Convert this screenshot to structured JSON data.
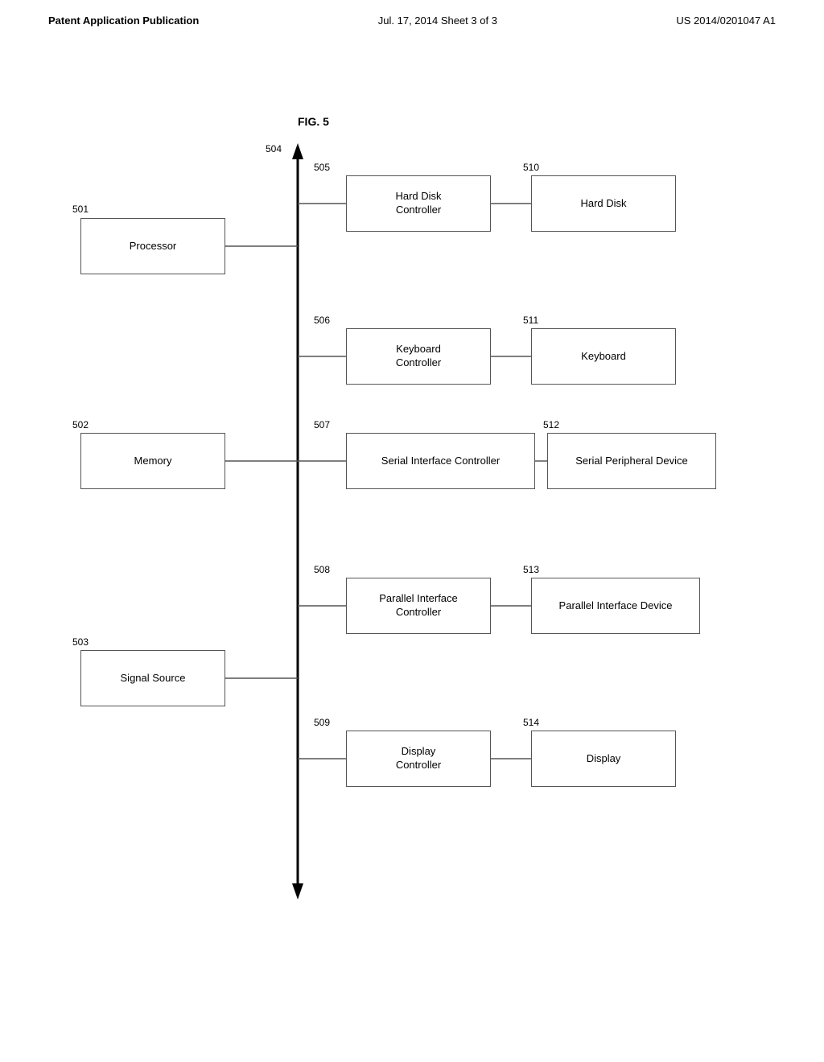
{
  "header": {
    "left": "Patent Application Publication",
    "center": "Jul. 17, 2014   Sheet 3 of 3",
    "right": "US 2014/0201047 A1"
  },
  "figure": {
    "label": "FIG. 5"
  },
  "ref_numbers": {
    "r501": "501",
    "r502": "502",
    "r503": "503",
    "r504": "504",
    "r505": "505",
    "r506": "506",
    "r507": "507",
    "r508": "508",
    "r509": "509",
    "r510": "510",
    "r511": "511",
    "r512": "512",
    "r513": "513",
    "r514": "514"
  },
  "boxes": {
    "processor": "Processor",
    "memory": "Memory",
    "signal_source": "Signal Source",
    "hard_disk_controller": "Hard Disk\nController",
    "keyboard_controller": "Keyboard\nController",
    "serial_interface_controller": "Serial Interface Controller",
    "parallel_interface_controller": "Parallel Interface\nController",
    "display_controller": "Display\nController",
    "hard_disk": "Hard Disk",
    "keyboard": "Keyboard",
    "serial_peripheral_device": "Serial Peripheral Device",
    "parallel_interface_device": "Parallel Interface Device",
    "display": "Display"
  }
}
